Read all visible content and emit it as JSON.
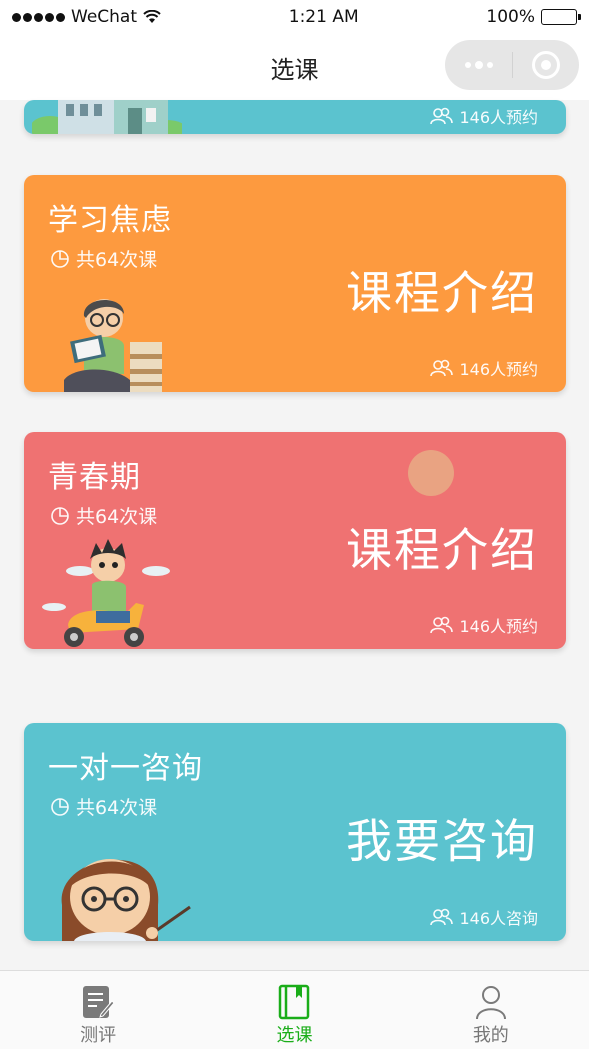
{
  "status": {
    "carrier": "WeChat",
    "time": "1:21 AM",
    "battery": "100%"
  },
  "nav": {
    "title": "选课"
  },
  "cards": [
    {
      "count": "146人预约",
      "color": "#5bc3cf"
    },
    {
      "title": "学习焦虑",
      "lessons": "共64次课",
      "cta": "课程介绍",
      "count": "146人预约",
      "color": "#fd9a3f"
    },
    {
      "title": "青春期",
      "lessons": "共64次课",
      "cta": "课程介绍",
      "count": "146人预约",
      "color": "#ef7272"
    },
    {
      "title": "一对一咨询",
      "lessons": "共64次课",
      "cta": "我要咨询",
      "count": "146人咨询",
      "color": "#5bc3cf"
    }
  ],
  "tabs": [
    {
      "label": "测评",
      "icon": "evaluation-icon"
    },
    {
      "label": "选课",
      "icon": "course-book-icon",
      "active": true
    },
    {
      "label": "我的",
      "icon": "person-icon"
    }
  ]
}
